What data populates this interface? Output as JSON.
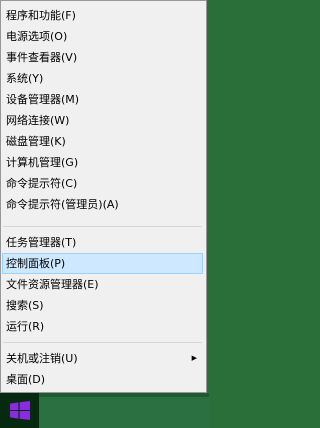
{
  "menu": {
    "groups": [
      [
        "程序和功能(F)",
        "电源选项(O)",
        "事件查看器(V)",
        "系统(Y)",
        "设备管理器(M)",
        "网络连接(W)",
        "磁盘管理(K)",
        "计算机管理(G)",
        "命令提示符(C)",
        "命令提示符(管理员)(A)"
      ],
      [
        "任务管理器(T)",
        "控制面板(P)",
        "文件资源管理器(E)",
        "搜索(S)",
        "运行(R)"
      ],
      [
        "关机或注销(U)",
        "桌面(D)"
      ]
    ],
    "highlighted_item": "控制面板(P)",
    "submenu_item": "关机或注销(U)",
    "submenu_arrow": "▶"
  },
  "icons": {
    "windows_logo": "windows-logo-icon"
  },
  "colors": {
    "menu_background": "#f0f0f0",
    "highlight_background": "#cde8ff",
    "highlight_border": "#99d1ff",
    "taskbar": "#2b7040",
    "logo": "#8a2be2"
  }
}
